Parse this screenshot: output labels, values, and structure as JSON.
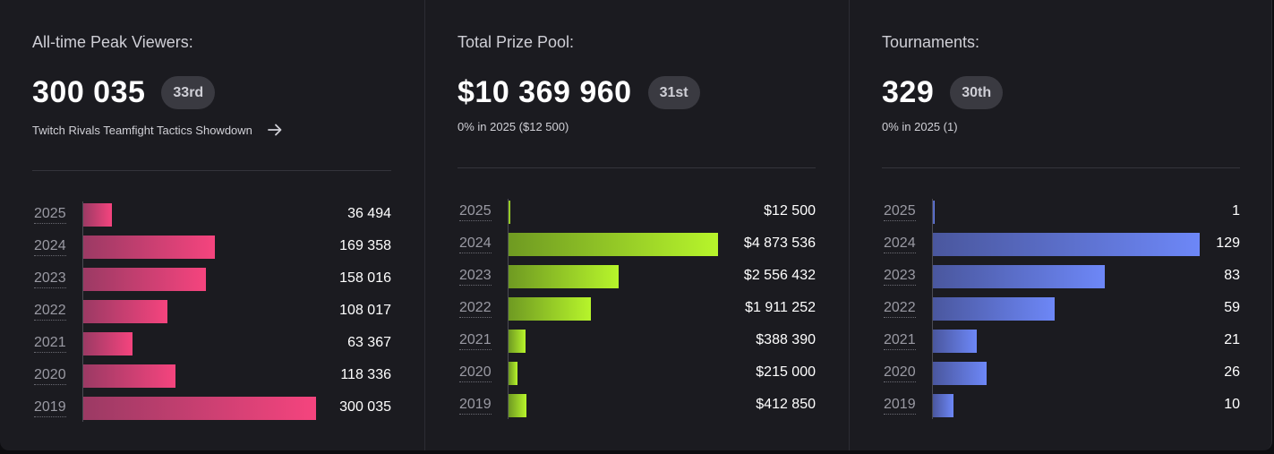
{
  "panels": [
    {
      "label": "All-time Peak Viewers:",
      "value": "300 035",
      "rank": "33rd",
      "sub": "Twitch Rivals Teamfight Tactics Showdown",
      "sub_icon": "arrow-right-icon",
      "color": "pink",
      "rows": [
        {
          "year": "2025",
          "value": "36 494",
          "num": 36494
        },
        {
          "year": "2024",
          "value": "169 358",
          "num": 169358
        },
        {
          "year": "2023",
          "value": "158 016",
          "num": 158016
        },
        {
          "year": "2022",
          "value": "108 017",
          "num": 108017
        },
        {
          "year": "2021",
          "value": "63 367",
          "num": 63367
        },
        {
          "year": "2020",
          "value": "118 336",
          "num": 118336
        },
        {
          "year": "2019",
          "value": "300 035",
          "num": 300035
        }
      ]
    },
    {
      "label": "Total Prize Pool:",
      "value": "$10 369 960",
      "rank": "31st",
      "sub": "0% in 2025 ($12 500)",
      "color": "green",
      "rows": [
        {
          "year": "2025",
          "value": "$12 500",
          "num": 12500
        },
        {
          "year": "2024",
          "value": "$4 873 536",
          "num": 4873536
        },
        {
          "year": "2023",
          "value": "$2 556 432",
          "num": 2556432
        },
        {
          "year": "2022",
          "value": "$1 911 252",
          "num": 1911252
        },
        {
          "year": "2021",
          "value": "$388 390",
          "num": 388390
        },
        {
          "year": "2020",
          "value": "$215 000",
          "num": 215000
        },
        {
          "year": "2019",
          "value": "$412 850",
          "num": 412850
        }
      ]
    },
    {
      "label": "Tournaments:",
      "value": "329",
      "rank": "30th",
      "sub": "0% in 2025 (1)",
      "color": "blue",
      "rows": [
        {
          "year": "2025",
          "value": "1",
          "num": 1
        },
        {
          "year": "2024",
          "value": "129",
          "num": 129
        },
        {
          "year": "2023",
          "value": "83",
          "num": 83
        },
        {
          "year": "2022",
          "value": "59",
          "num": 59
        },
        {
          "year": "2021",
          "value": "21",
          "num": 21
        },
        {
          "year": "2020",
          "value": "26",
          "num": 26
        },
        {
          "year": "2019",
          "value": "10",
          "num": 10
        }
      ]
    }
  ],
  "colors": {
    "pink": "#f5447e",
    "green": "#b7f52b",
    "blue": "#6d87f7",
    "background": "#1b1b20",
    "badge": "#3a3a41"
  }
}
